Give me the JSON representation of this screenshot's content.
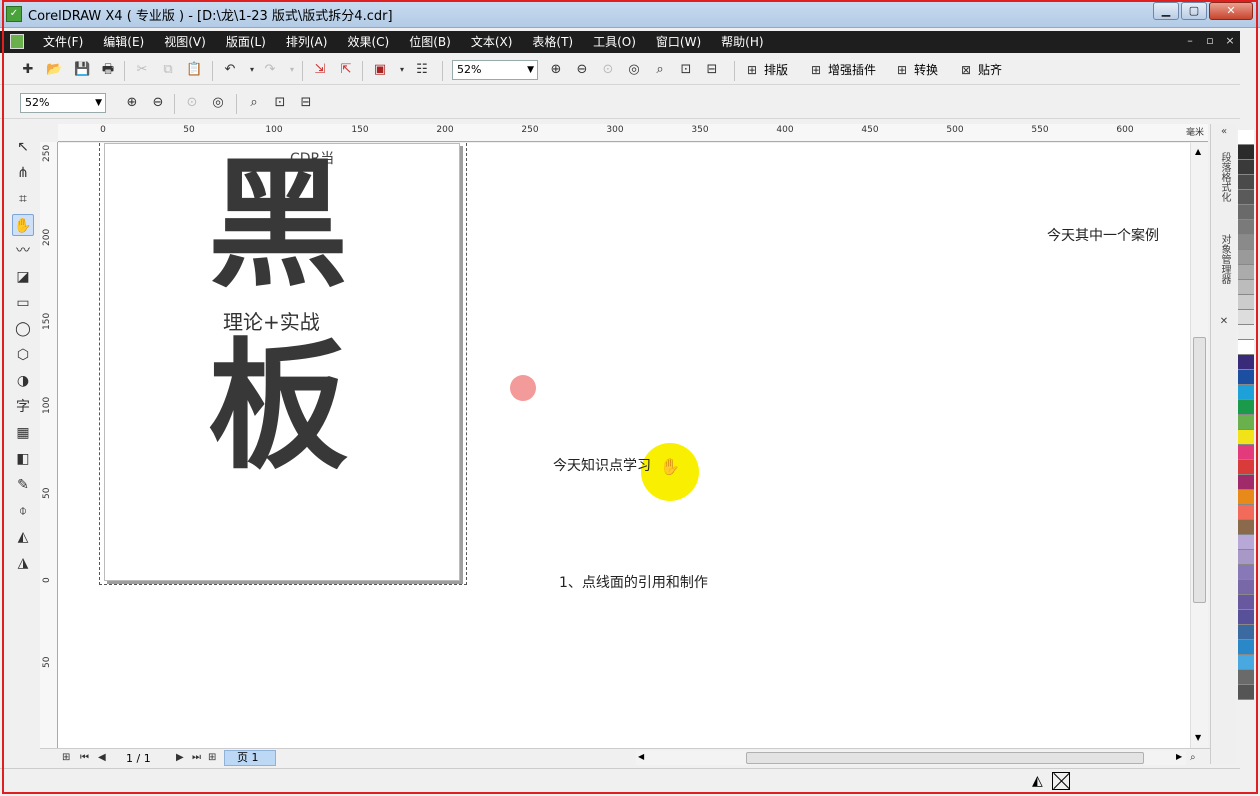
{
  "window": {
    "title": "CorelDRAW X4 ( 专业版 ) - [D:\\龙\\1-23 版式\\版式拆分4.cdr]",
    "min_label": "▁",
    "max_label": "▢",
    "close_label": "✕"
  },
  "menu": [
    "文件(F)",
    "编辑(E)",
    "视图(V)",
    "版面(L)",
    "排列(A)",
    "效果(C)",
    "位图(B)",
    "文本(X)",
    "表格(T)",
    "工具(O)",
    "窗口(W)",
    "帮助(H)"
  ],
  "mdi": {
    "min": "–",
    "restore": "▫",
    "close": "×"
  },
  "toolbar1": {
    "zoom": "52%",
    "plugins": [
      "排版",
      "增强插件",
      "转换",
      "贴齐"
    ]
  },
  "toolbar2": {
    "zoom": "52%"
  },
  "ruler": {
    "h_labels": [
      "0",
      "50",
      "100",
      "150",
      "200",
      "250",
      "300",
      "350",
      "400",
      "450",
      "500",
      "550",
      "600"
    ],
    "h_unit": "毫米",
    "v_labels": [
      "250",
      "200",
      "150",
      "100",
      "50",
      "0",
      "50"
    ]
  },
  "poster": {
    "top_text": "CDR当",
    "big_char_1": "黑",
    "subtitle": "理论+实战",
    "big_char_2": "板"
  },
  "notes": {
    "case": "今天其中一个案例",
    "today": "今天知识点学习",
    "point1": "1、点线面的引用和制作"
  },
  "pagebar": {
    "count": "1 / 1",
    "tab": "页 1"
  },
  "docker": {
    "tab1": "段落格式化",
    "tab2": "对象管理器"
  },
  "palette": [
    "#ffffff",
    "#2b2b2b",
    "#3a3a3a",
    "#4a4a4a",
    "#5a5a5a",
    "#6a6a6a",
    "#7a7a7a",
    "#8a8a8a",
    "#9a9a9a",
    "#ababab",
    "#bcbcbc",
    "#cccccc",
    "#dddddd",
    "#eeeeee",
    "#ffffff",
    "#3a2a7a",
    "#1d4fa0",
    "#1ea0d8",
    "#1a9a4a",
    "#6ab04c",
    "#f2e21a",
    "#e23a7a",
    "#d93a3a",
    "#a02a6a",
    "#e88a1a",
    "#f26a5a",
    "#8a6a4a",
    "#b8a8d8",
    "#a898c8",
    "#8878b8",
    "#7868a8",
    "#6858a0",
    "#585098",
    "#3a6aa0",
    "#2a88c8",
    "#4aa8e0",
    "#6a6a6a",
    "#555555"
  ]
}
